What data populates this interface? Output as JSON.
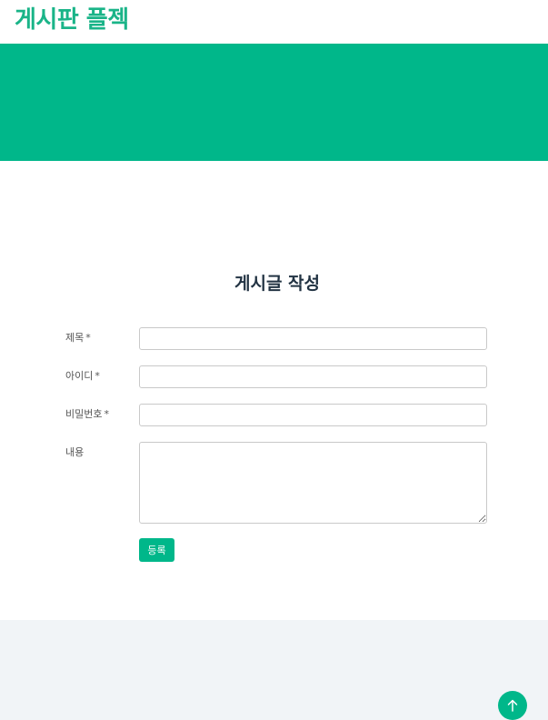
{
  "header": {
    "brand": "게시판 플젝"
  },
  "form": {
    "title": "게시글 작성",
    "fields": [
      {
        "label": "제목",
        "required_mark": "*",
        "value": "",
        "placeholder": ""
      },
      {
        "label": "아이디",
        "required_mark": "*",
        "value": "",
        "placeholder": ""
      },
      {
        "label": "비밀번호",
        "required_mark": "*",
        "value": "",
        "placeholder": ""
      },
      {
        "label": "내용",
        "value": "",
        "placeholder": ""
      }
    ],
    "submit_label": "등록"
  },
  "scroll_top": {
    "icon": "arrow-up-icon"
  },
  "colors": {
    "accent": "#00b78a",
    "brand_text": "#1ab488",
    "title_text": "#223343",
    "footer_bg": "#f1f4f7"
  }
}
